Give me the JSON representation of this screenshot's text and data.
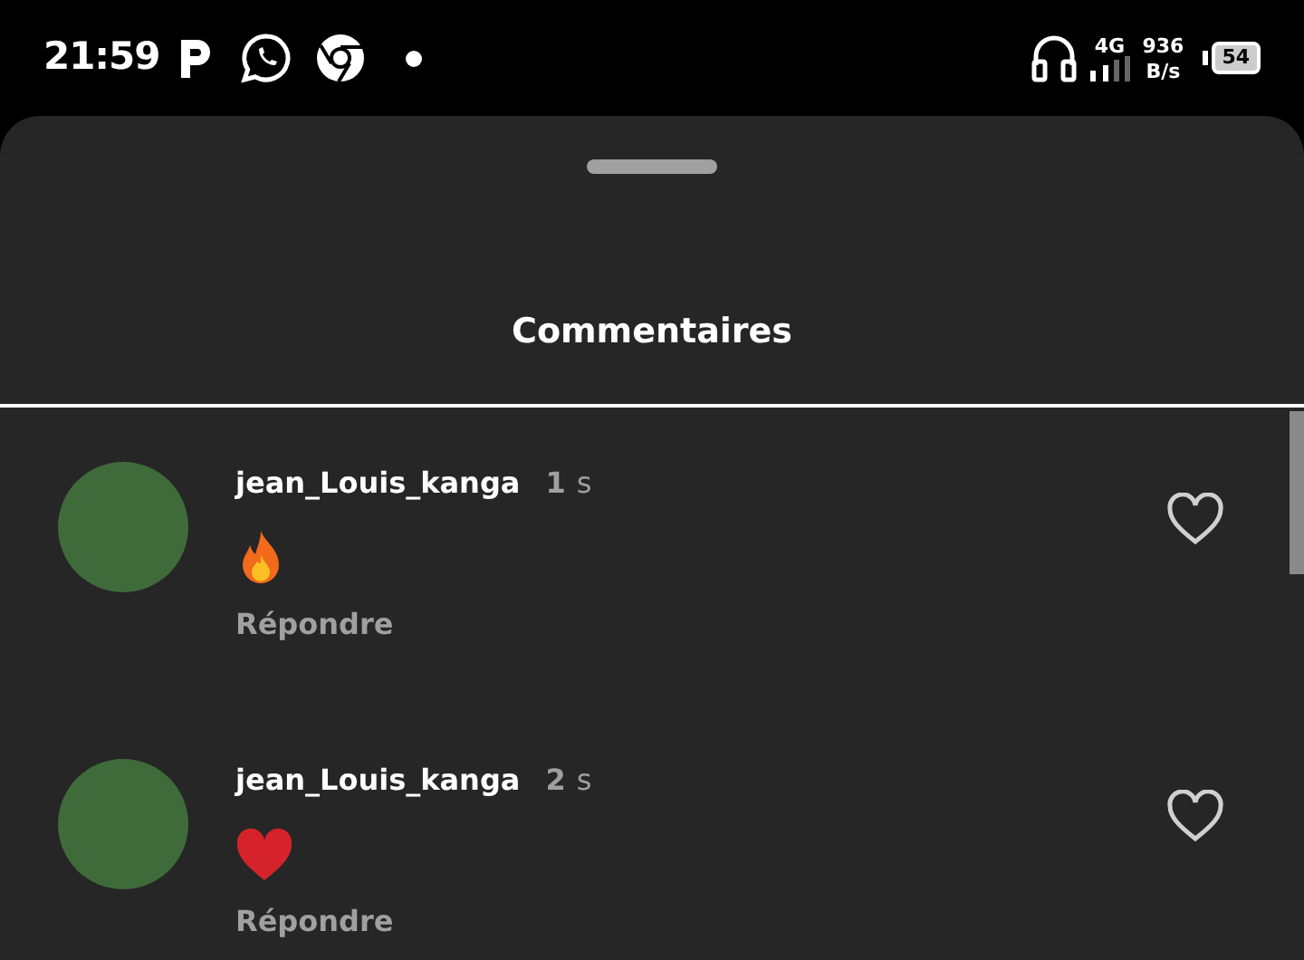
{
  "status_bar": {
    "time": "21:59",
    "network": "4G",
    "speed_value": "936",
    "speed_unit": "B/s",
    "battery": "54"
  },
  "sheet": {
    "title": "Commentaires"
  },
  "comments": [
    {
      "username": "jean_Louis_kanga",
      "age_number": "1",
      "age_unit": "s",
      "kind": "fire",
      "reply": "Répondre",
      "liked": false
    },
    {
      "username": "jean_Louis_kanga",
      "age_number": "2",
      "age_unit": "s",
      "kind": "heart",
      "reply": "Répondre",
      "liked": false
    }
  ]
}
